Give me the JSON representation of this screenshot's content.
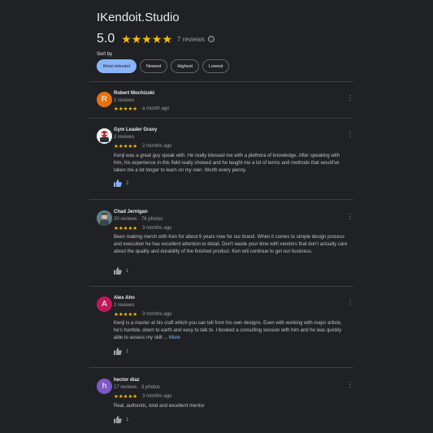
{
  "header": {
    "title": "IKendoit.Studio",
    "rating": "5.0",
    "stars": "★★★★★",
    "review_count": "7 reviews",
    "info_icon": "ⓘ"
  },
  "sort": {
    "label": "Sort by",
    "options": [
      "Most relevant",
      "Newest",
      "Highest",
      "Lowest"
    ],
    "selected": "Most relevant"
  },
  "reviews": [
    {
      "name": "Robert Mochizuki",
      "meta": "2 reviews",
      "stars": "★★★★★",
      "time": "a month ago",
      "avatar_letter": "R",
      "avatar_color": "#e8710a"
    },
    {
      "name": "Gym Leader Gravy",
      "meta": "2 reviews",
      "stars": "★★★★★",
      "time": "2 months ago",
      "text": "Kenji was a great guy speak with. He really blessed me with a plethora of knowledge. After speaking with him, his experience in this field really showed and he taught me a lot of terms and methods that would've taken me a lot longer to learn on my own. Worth every penny.",
      "likes": "2",
      "liked": true
    },
    {
      "name": "Chad Jernigan",
      "meta": "20 reviews · 76 photos",
      "stars": "★★★★★",
      "time": "3 months ago",
      "text": "Been making merch with Ken for about 6 years now for our brand. When it comes to simple design process and execution he has excellent attention to detail. Don't waste your time with vendors that don't actually care about the quality and durability of the finished product. Ken will continue to get our business.",
      "likes": "1"
    },
    {
      "name": "Alex Ahn",
      "meta": "2 reviews",
      "stars": "★★★★★",
      "time": "3 months ago",
      "text": "Kenji is a master at his craft which you can tell from his own designs. Even with working with major artists, he's humble, down to earth and easy to talk to. I booked a consulting session with him and he was quickly able to assess my skill ...",
      "more": "More",
      "likes": "1",
      "avatar_letter": "A",
      "avatar_color": "#c2185b"
    },
    {
      "name": "hector diaz",
      "meta": "17 reviews · 3 photos",
      "stars": "★★★★★",
      "time": "3 months ago",
      "text": "Real, authentic, kind and excellent mentor",
      "likes": "1",
      "avatar_letter": "h",
      "avatar_color": "#7e57c2"
    }
  ],
  "icons": {
    "thumb": "thumbs-up-icon",
    "menu": "more-vert-icon"
  }
}
